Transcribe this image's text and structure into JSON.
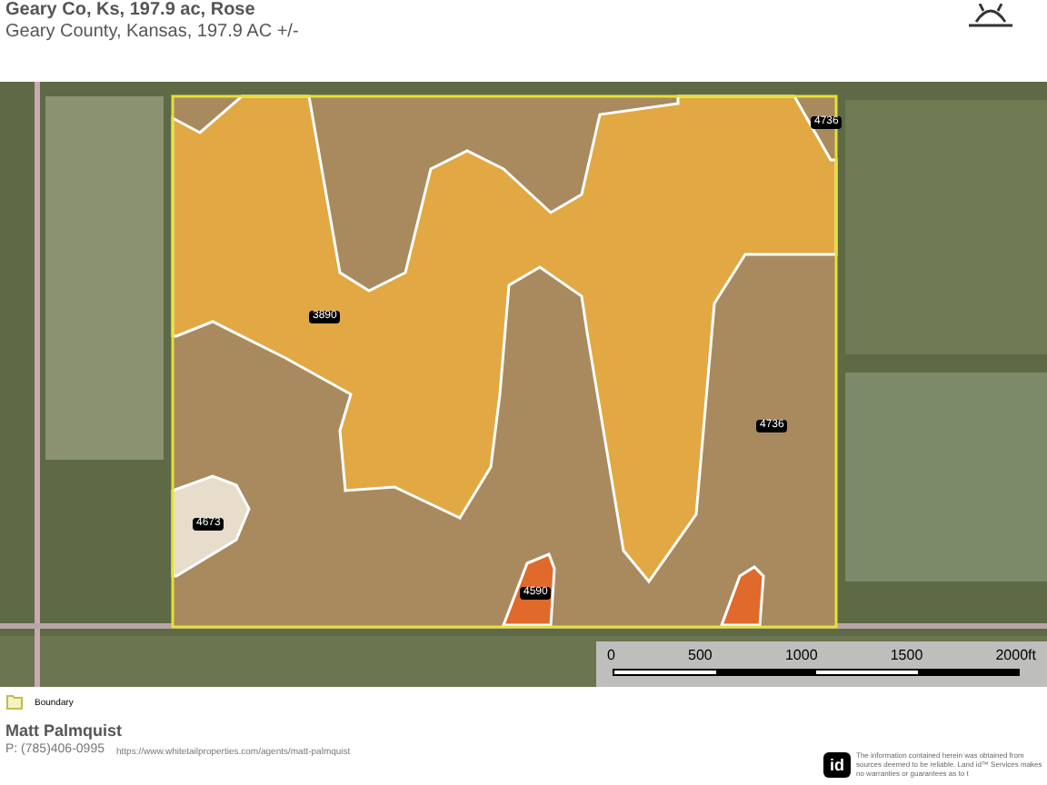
{
  "header": {
    "title": "Geary Co, Ks, 197.9 ac, Rose",
    "subtitle": "Geary County, Kansas, 197.9 AC +/-"
  },
  "map": {
    "soil_labels": [
      "3890",
      "4736",
      "4736",
      "4673",
      "4590"
    ]
  },
  "scale_bar": {
    "labels": [
      "0",
      "500",
      "1000",
      "1500",
      "2000ft"
    ]
  },
  "legend": [
    {
      "label": "Boundary"
    }
  ],
  "footer": {
    "agent_name": "Matt Palmquist",
    "phone": "P: (785)406-0995",
    "url": "https://www.whitetailproperties.com/agents/matt-palmquist",
    "logo_text": "id",
    "disclaimer": "The information contained herein was obtained from sources deemed to be reliable. Land id™ Services makes no warranties or guarantees as to t"
  }
}
